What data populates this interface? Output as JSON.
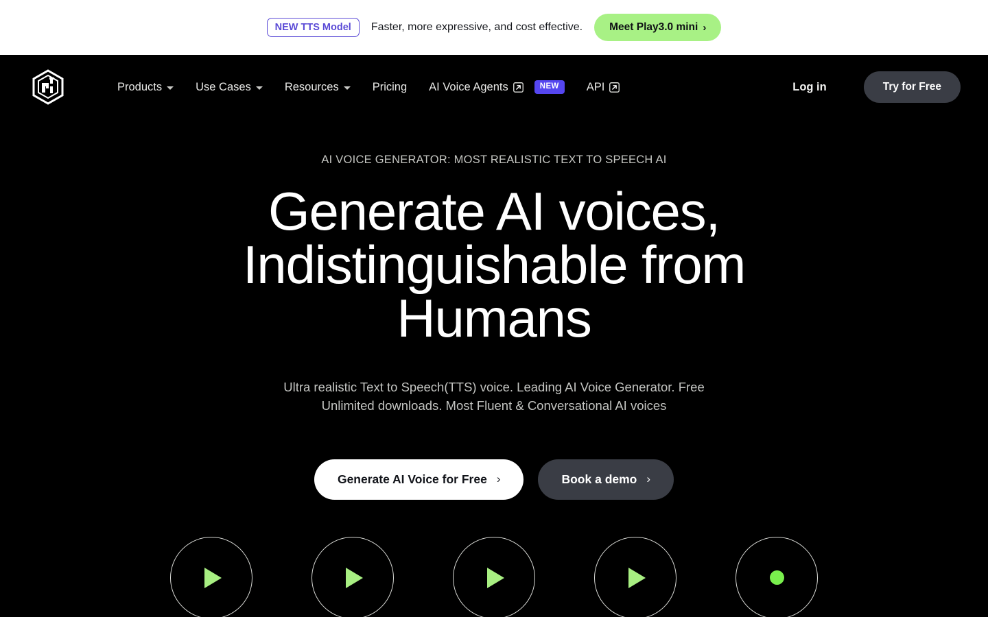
{
  "banner": {
    "badge": "NEW TTS Model",
    "message": "Faster, more expressive, and cost effective.",
    "cta_label": "Meet Play3.0 mini",
    "cta_chevron": "›",
    "badge_color": "#5b4bd6",
    "cta_bg": "#a8f185"
  },
  "nav": {
    "logo_name": "play-ht-cube-logo",
    "items": [
      {
        "label": "Products",
        "has_caret": true,
        "external": false,
        "badge": null
      },
      {
        "label": "Use Cases",
        "has_caret": true,
        "external": false,
        "badge": null
      },
      {
        "label": "Resources",
        "has_caret": true,
        "external": false,
        "badge": null
      },
      {
        "label": "Pricing",
        "has_caret": false,
        "external": false,
        "badge": null
      },
      {
        "label": "AI Voice Agents",
        "has_caret": false,
        "external": true,
        "badge": "NEW"
      },
      {
        "label": "API",
        "has_caret": false,
        "external": true,
        "badge": null
      }
    ],
    "login_label": "Log in",
    "try_label": "Try for Free",
    "new_badge_color": "#5546f0",
    "try_bg": "#3a3d45"
  },
  "hero": {
    "eyebrow": "AI VOICE GENERATOR: MOST REALISTIC TEXT TO SPEECH AI",
    "headline": "Generate AI voices, Indistinguishable from Humans",
    "subhead": "Ultra realistic Text to Speech(TTS) voice. Leading AI Voice Generator. Free Unlimited downloads. Most Fluent & Conversational AI voices",
    "primary_cta": "Generate AI Voice for Free",
    "secondary_cta": "Book a demo",
    "chevron": "›"
  },
  "voice_circles": {
    "accent_green": "#a8ef82",
    "record_green": "#79ef4d",
    "items": [
      {
        "kind": "play",
        "name": "voice-sample-1"
      },
      {
        "kind": "play",
        "name": "voice-sample-2"
      },
      {
        "kind": "play",
        "name": "voice-sample-3"
      },
      {
        "kind": "play",
        "name": "voice-sample-4"
      },
      {
        "kind": "record",
        "name": "voice-record"
      }
    ]
  }
}
